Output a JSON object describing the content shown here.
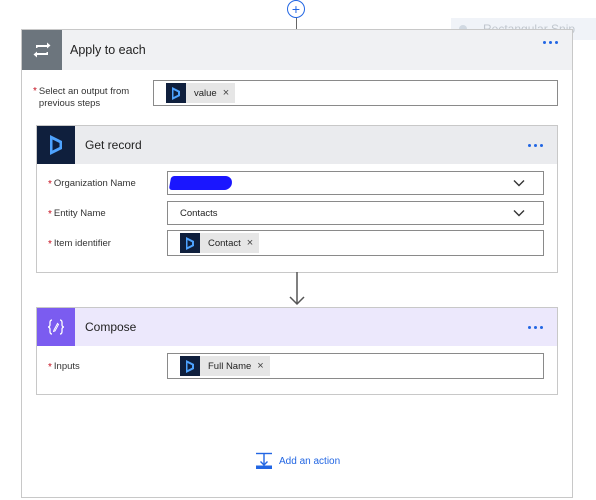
{
  "tooltip": {
    "text": "Rectangular Snip"
  },
  "loop": {
    "title": "Apply to each",
    "field_label_line1": "Select an output from",
    "field_label_line2": "previous steps",
    "token": "value"
  },
  "get_record": {
    "title": "Get record",
    "org_label": "Organization Name",
    "entity_label": "Entity Name",
    "entity_value": "Contacts",
    "item_label": "Item identifier",
    "item_token": "Contact"
  },
  "compose": {
    "title": "Compose",
    "inputs_label": "Inputs",
    "inputs_token": "Full Name"
  },
  "footer": {
    "add_action": "Add an action"
  },
  "colors": {
    "accent": "#2266e3",
    "dynamics": "#0f1f3d",
    "compose": "#7b5cf0",
    "compose_header": "#ece8fc",
    "loop_icon": "#6c757d"
  }
}
